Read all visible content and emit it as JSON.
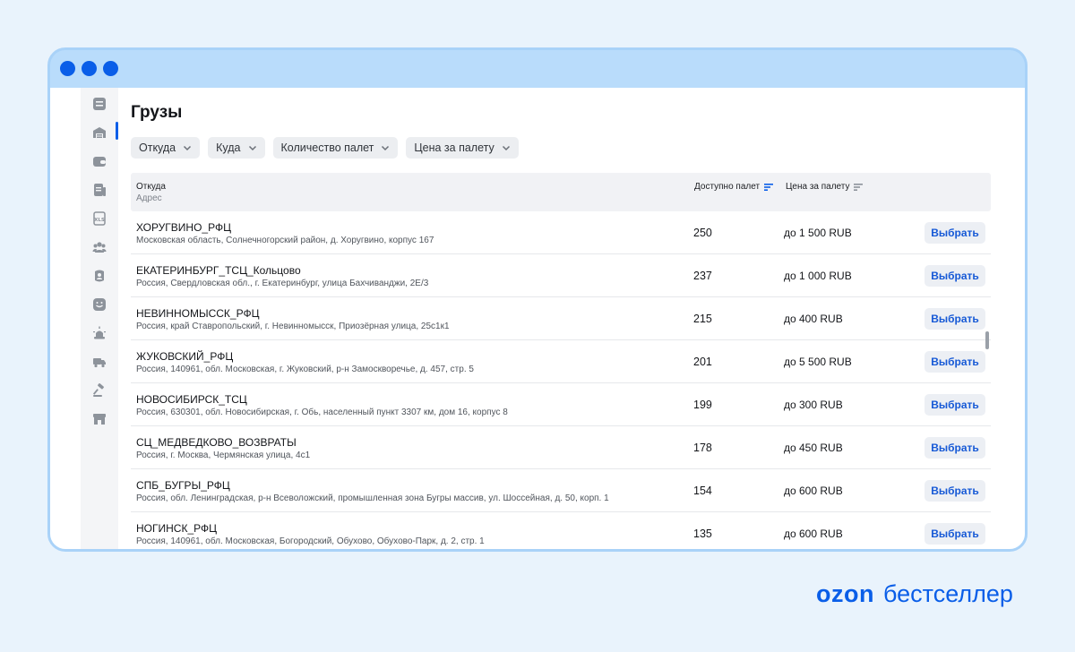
{
  "page": {
    "title": "Грузы"
  },
  "sidebar": {
    "items": [
      {
        "icon": "list-icon"
      },
      {
        "icon": "warehouse-icon",
        "active": true
      },
      {
        "icon": "wallet-icon"
      },
      {
        "icon": "document-icon"
      },
      {
        "icon": "xls-file-icon"
      },
      {
        "icon": "users-icon"
      },
      {
        "icon": "user-badge-icon"
      },
      {
        "icon": "chat-icon"
      },
      {
        "icon": "alarm-icon"
      },
      {
        "icon": "truck-icon"
      },
      {
        "icon": "gavel-icon"
      },
      {
        "icon": "store-icon"
      }
    ]
  },
  "filters": [
    {
      "label": "Откуда"
    },
    {
      "label": "Куда"
    },
    {
      "label": "Количество палет"
    },
    {
      "label": "Цена за палету"
    }
  ],
  "table": {
    "header": {
      "from": "Откуда",
      "address": "Адрес",
      "available": "Доступно палет",
      "price": "Цена за палету"
    },
    "rows": [
      {
        "name": "ХОРУГВИНО_РФЦ",
        "address": "Московская область, Солнечногорский район, д. Хоругвино, корпус 167",
        "count": "250",
        "price": "до 1 500 RUB",
        "button": "Выбрать"
      },
      {
        "name": "ЕКАТЕРИНБУРГ_ТСЦ_Кольцово",
        "address": "Россия, Свердловская обл., г. Екатеринбург, улица Бахчиванджи, 2Е/3",
        "count": "237",
        "price": "до 1 000 RUB",
        "button": "Выбрать"
      },
      {
        "name": "НЕВИННОМЫССК_РФЦ",
        "address": "Россия, край Ставропольский, г. Невинномысск, Приозёрная улица, 25с1к1",
        "count": "215",
        "price": "до 400 RUB",
        "button": "Выбрать"
      },
      {
        "name": "ЖУКОВСКИЙ_РФЦ",
        "address": "Россия, 140961, обл. Московская, г. Жуковский, р-н Замоскворечье, д. 457, стр. 5",
        "count": "201",
        "price": "до 5 500 RUB",
        "button": "Выбрать"
      },
      {
        "name": "НОВОСИБИРСК_ТСЦ",
        "address": "Россия, 630301, обл. Новосибирская, г. Обь, населенный пункт 3307 км, дом 16, корпус 8",
        "count": "199",
        "price": "до 300 RUB",
        "button": "Выбрать"
      },
      {
        "name": "СЦ_МЕДВЕДКОВО_ВОЗВРАТЫ",
        "address": "Россия, г. Москва, Чермянская улица, 4с1",
        "count": "178",
        "price": "до 450 RUB",
        "button": "Выбрать"
      },
      {
        "name": "СПБ_БУГРЫ_РФЦ",
        "address": "Россия, обл. Ленинградская, р-н Всеволожский, промышленная зона Бугры массив, ул. Шоссейная, д. 50, корп. 1",
        "count": "154",
        "price": "до 600 RUB",
        "button": "Выбрать"
      },
      {
        "name": "НОГИНСК_РФЦ",
        "address": "Россия, 140961, обл. Московская, Богородский, Обухово, Обухово-Парк, д. 2, стр. 1",
        "count": "135",
        "price": "до 600 RUB",
        "button": "Выбрать"
      }
    ]
  },
  "brand": {
    "logo": "ozon",
    "text": "бестселлер"
  },
  "colors": {
    "accent": "#0a5ee8",
    "background": "#e9f3fc",
    "window_frame": "#b9dcfb"
  }
}
